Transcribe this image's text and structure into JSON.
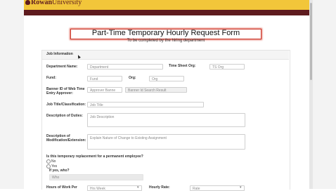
{
  "header": {
    "logo_text": "Rowan",
    "logo_text2": "University"
  },
  "form": {
    "title": "Part-Time Temporary Hourly Request Form",
    "subtitle": "To be completed by the hiring department",
    "section_title": "Job Information"
  },
  "fields": {
    "department_label": "Department Name:",
    "department_placeholder": "Department",
    "timesheet_label": "Time Sheet Org:",
    "timesheet_placeholder": "TS Org",
    "fund_label": "Fund:",
    "fund_placeholder": "Fund",
    "org_label": "Org:",
    "org_placeholder": "Org",
    "banner_label_1": "Banner ID of Web Time",
    "banner_label_2": "Entry Approver:",
    "approver_placeholder": "Approver Banne",
    "banner_search_placeholder": "Banner Id Search Result",
    "job_title_label": "Job Title/Classification:",
    "job_title_placeholder": "Job Title",
    "duties_label": "Description of Duties:",
    "duties_placeholder": "Job Description",
    "modification_label_1": "Description of",
    "modification_label_2": "Modification/Extension:",
    "modification_placeholder": "Explain Nature of Change to Existing Assignment",
    "replacement_question": "Is this temporary replacement for a permanent employee?",
    "option_no": "No",
    "option_yes": "Yes",
    "if_yes_label": "If yes, who?",
    "who_placeholder": "Who",
    "hours_label": "Hours of Work Per",
    "hours_placeholder": "Hrs Week",
    "hourly_rate_label": "Hourly Rate:",
    "rate_placeholder": "Rate"
  },
  "colors": {
    "brand_gold": "#f2c63a",
    "brand_brown": "#5e1b1e",
    "title_border": "#cc3b2e"
  }
}
